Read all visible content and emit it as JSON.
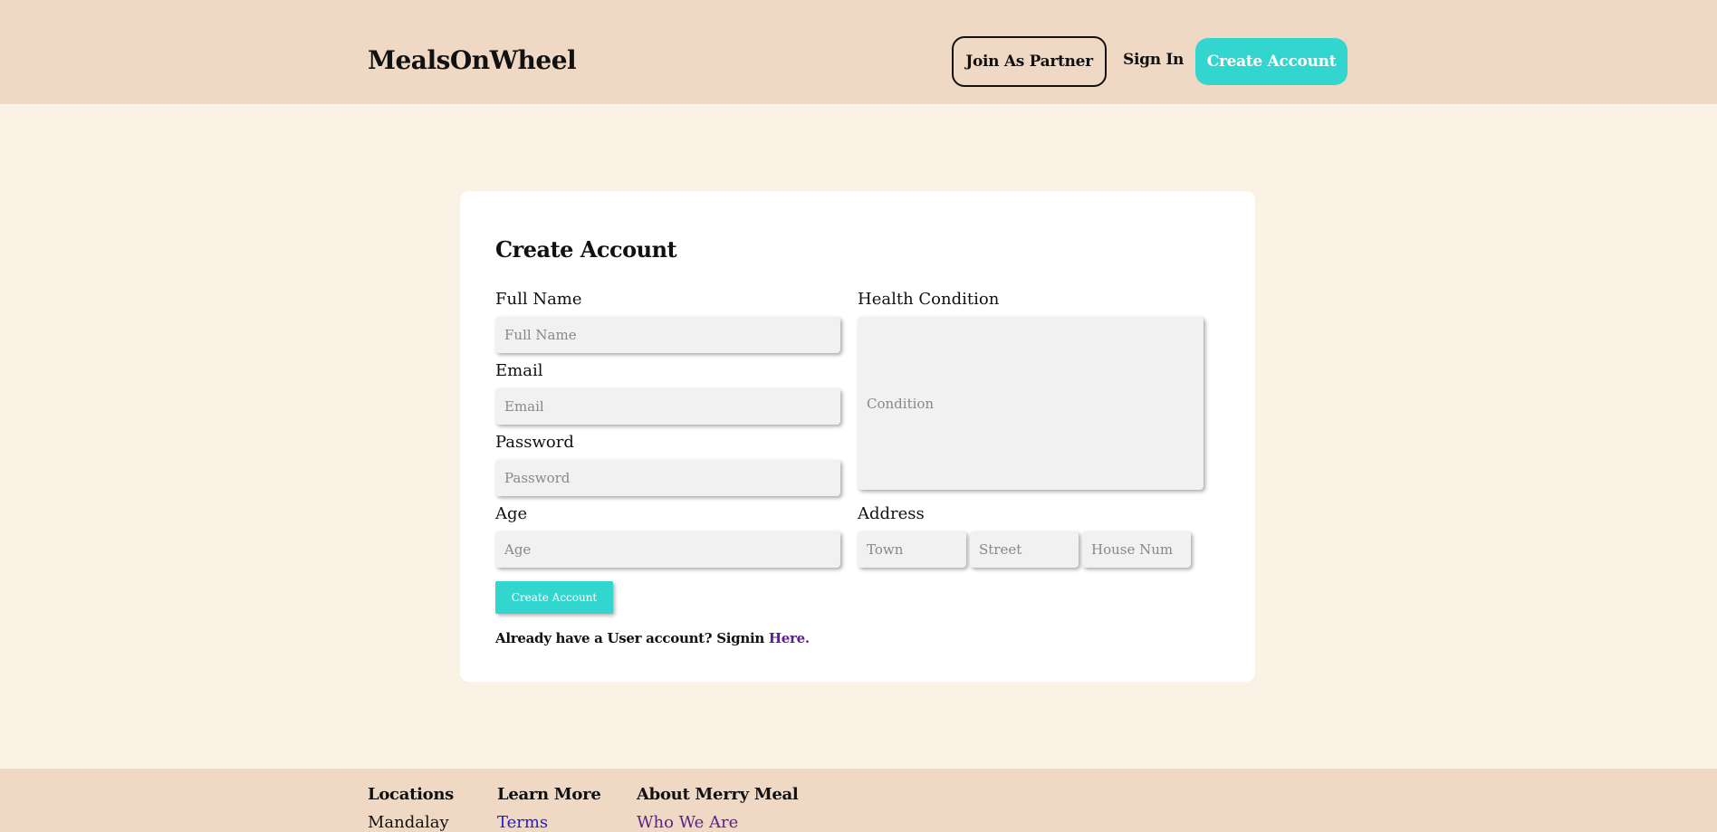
{
  "header": {
    "brand": "MealsOnWheel",
    "join_partner": "Join As Partner",
    "sign_in": "Sign In",
    "create_account": "Create Account"
  },
  "form": {
    "title": "Create Account",
    "full_name": {
      "label": "Full Name",
      "placeholder": "Full Name"
    },
    "email": {
      "label": "Email",
      "placeholder": "Email"
    },
    "password": {
      "label": "Password",
      "placeholder": "Password"
    },
    "age": {
      "label": "Age",
      "placeholder": "Age"
    },
    "health": {
      "label": "Health Condition",
      "placeholder": "Condition"
    },
    "address": {
      "label": "Address",
      "town_placeholder": "Town",
      "street_placeholder": "Street",
      "house_placeholder": "House Num"
    },
    "submit": "Create Account",
    "already_text": "Already have a User account? Signin ",
    "here_link": "Here."
  },
  "footer": {
    "col1": {
      "heading": "Locations",
      "link": "Mandalay"
    },
    "col2": {
      "heading": "Learn More",
      "link": "Terms"
    },
    "col3": {
      "heading": "About Merry Meal",
      "link": "Who We Are"
    }
  },
  "colors": {
    "header_bg": "#f0d9c4",
    "page_bg": "#faf2e4",
    "accent": "#33d6cf",
    "link_purple": "#5a1f8a",
    "link_blue": "#1a1ae0"
  }
}
